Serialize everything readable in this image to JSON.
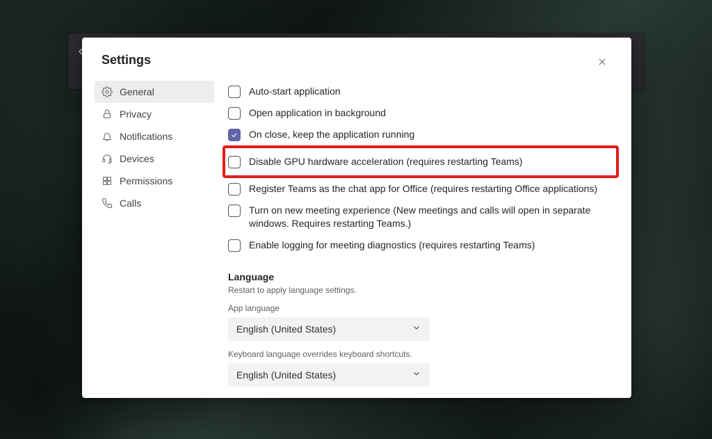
{
  "dialog": {
    "title": "Settings"
  },
  "sidebar": {
    "items": [
      {
        "icon": "gear",
        "label": "General",
        "active": true
      },
      {
        "icon": "lock",
        "label": "Privacy",
        "active": false
      },
      {
        "icon": "bell",
        "label": "Notifications",
        "active": false
      },
      {
        "icon": "headset",
        "label": "Devices",
        "active": false
      },
      {
        "icon": "grid",
        "label": "Permissions",
        "active": false
      },
      {
        "icon": "phone",
        "label": "Calls",
        "active": false
      }
    ]
  },
  "settings": {
    "items": [
      {
        "label": "Auto-start application",
        "checked": false,
        "highlight": false
      },
      {
        "label": "Open application in background",
        "checked": false,
        "highlight": false
      },
      {
        "label": "On close, keep the application running",
        "checked": true,
        "highlight": false
      },
      {
        "label": "Disable GPU hardware acceleration (requires restarting Teams)",
        "checked": false,
        "highlight": true
      },
      {
        "label": "Register Teams as the chat app for Office (requires restarting Office applications)",
        "checked": false,
        "highlight": false
      },
      {
        "label": "Turn on new meeting experience (New meetings and calls will open in separate windows. Requires restarting Teams.)",
        "checked": false,
        "highlight": false
      },
      {
        "label": "Enable logging for meeting diagnostics (requires restarting Teams)",
        "checked": false,
        "highlight": false
      }
    ]
  },
  "language": {
    "heading": "Language",
    "restart_note": "Restart to apply language settings.",
    "app_language_label": "App language",
    "app_language_value": "English (United States)",
    "keyboard_note": "Keyboard language overrides keyboard shortcuts.",
    "keyboard_language_value": "English (United States)"
  }
}
